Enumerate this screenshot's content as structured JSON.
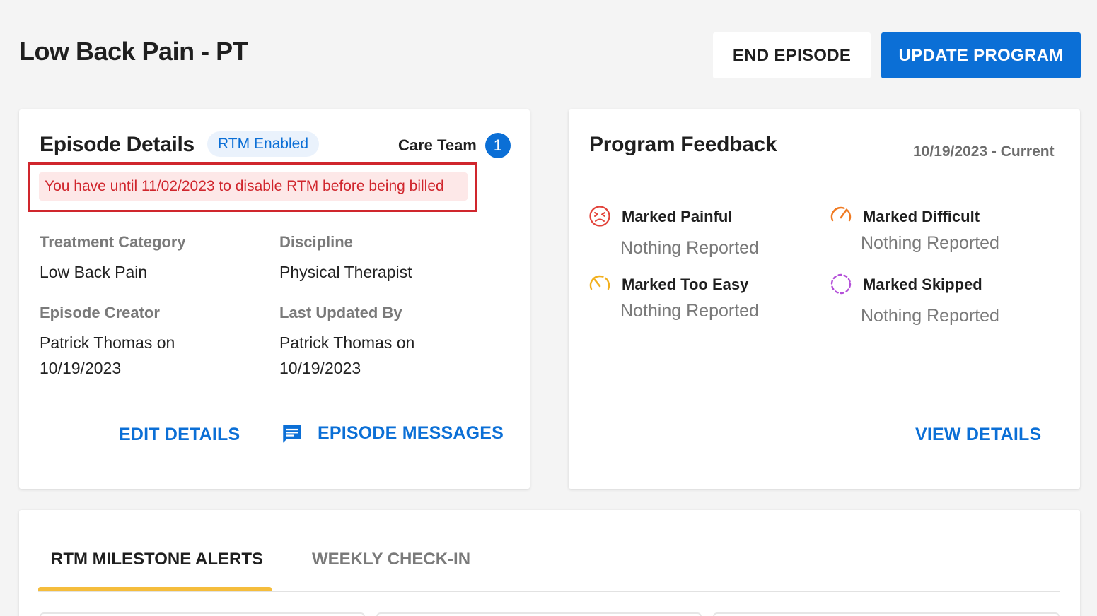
{
  "header": {
    "title": "Low Back Pain - PT",
    "end_episode_label": "END EPISODE",
    "update_program_label": "UPDATE PROGRAM"
  },
  "episode": {
    "title": "Episode Details",
    "rtm_badge": "RTM Enabled",
    "care_team_label": "Care Team",
    "care_team_count": "1",
    "warning": "You have until 11/02/2023 to disable RTM before being billed",
    "fields": {
      "treatment_category_label": "Treatment Category",
      "treatment_category_value": "Low Back Pain",
      "discipline_label": "Discipline",
      "discipline_value": "Physical Therapist",
      "creator_label": "Episode Creator",
      "creator_value_line1": "Patrick Thomas on",
      "creator_value_line2": "10/19/2023",
      "updated_by_label": "Last Updated By",
      "updated_by_value_line1": "Patrick Thomas on",
      "updated_by_value_line2": "10/19/2023"
    },
    "edit_details_label": "EDIT DETAILS",
    "messages_label": "EPISODE MESSAGES"
  },
  "feedback": {
    "title": "Program Feedback",
    "date_range": "10/19/2023 - Current",
    "items": [
      {
        "label": "Marked Painful",
        "value": "Nothing Reported",
        "icon": "painful-face-icon",
        "color": "#e2433a"
      },
      {
        "label": "Marked Difficult",
        "value": "Nothing Reported",
        "icon": "gauge-difficult-icon",
        "color": "#f07a22"
      },
      {
        "label": "Marked Too Easy",
        "value": "Nothing Reported",
        "icon": "gauge-easy-icon",
        "color": "#f2b01e"
      },
      {
        "label": "Marked Skipped",
        "value": "Nothing Reported",
        "icon": "skipped-dashed-circle-icon",
        "color": "#b44fd9"
      }
    ],
    "view_details_label": "VIEW DETAILS"
  },
  "tabs": {
    "items": [
      {
        "label": "RTM MILESTONE ALERTS",
        "active": true
      },
      {
        "label": "WEEKLY CHECK-IN",
        "active": false
      }
    ]
  },
  "colors": {
    "primary": "#0b6fd6",
    "warning": "#d0262d",
    "tab_accent": "#f5bd3c"
  }
}
